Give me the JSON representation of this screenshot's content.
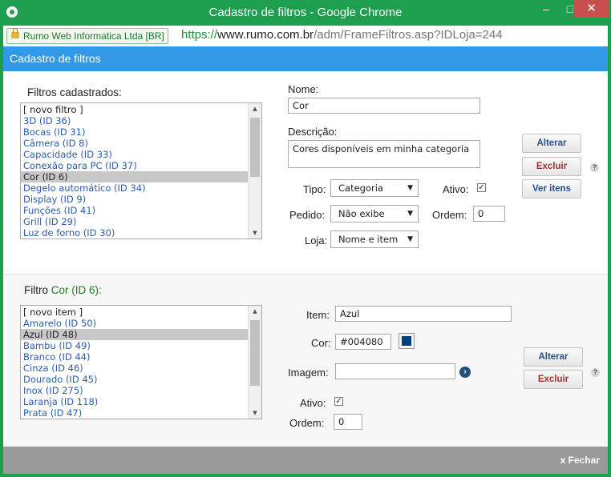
{
  "window": {
    "title": "Cadastro de filtros - Google Chrome",
    "minimize": "–",
    "maximize": "□",
    "close": "✕"
  },
  "addressbar": {
    "security_label": "Rumo Web Informatica Ltda [BR]",
    "url_protocol": "https://",
    "url_domain": "www.rumo.com.br",
    "url_path": "/adm/FrameFiltros.asp?IDLoja=244"
  },
  "header": {
    "title": "Cadastro de filtros"
  },
  "filters": {
    "heading": "Filtros cadastrados:",
    "items": [
      "[ novo filtro ]",
      "3D (ID 36)",
      "Bocas (ID 31)",
      "Câmera (ID 8)",
      "Capacidade (ID 33)",
      "Conexão para PC (ID 37)",
      "Cor (ID 6)",
      "Degelo automático (ID 34)",
      "Display (ID 9)",
      "Funções (ID 41)",
      "Grill (ID 29)",
      "Luz de forno (ID 30)"
    ],
    "selected_index": 6
  },
  "form": {
    "nome_label": "Nome:",
    "nome_value": "Cor",
    "descricao_label": "Descrição:",
    "descricao_value": "Cores disponíveis em minha categoria",
    "tipo_label": "Tipo:",
    "tipo_value": "Categoria",
    "ativo_label": "Ativo:",
    "ativo_checked": true,
    "pedido_label": "Pedido:",
    "pedido_value": "Não exibe",
    "ordem_label": "Ordem:",
    "ordem_value": "0",
    "loja_label": "Loja:",
    "loja_value": "Nome e item",
    "btn_alterar": "Alterar",
    "btn_excluir": "Excluir",
    "btn_ver_itens": "Ver itens",
    "help": "?"
  },
  "filtro_items": {
    "heading_prefix": "Filtro",
    "heading_name": "Cor (ID 6):",
    "items": [
      "[ novo item ]",
      "Amarelo (ID 50)",
      "Azul (ID 48)",
      "Bambu (ID 49)",
      "Branco (ID 44)",
      "Cinza (ID 46)",
      "Dourado (ID 45)",
      "Inox (ID 275)",
      "Laranja (ID 118)",
      "Prata (ID 47)"
    ],
    "selected_index": 2
  },
  "item_form": {
    "item_label": "Item:",
    "item_value": "Azul",
    "cor_label": "Cor:",
    "cor_value": "#004080",
    "imagem_label": "Imagem:",
    "imagem_value": "",
    "ativo_label": "Ativo:",
    "ativo_checked": true,
    "ordem_label": "Ordem:",
    "ordem_value": "0",
    "btn_alterar": "Alterar",
    "btn_excluir": "Excluir",
    "help": "?"
  },
  "footer": {
    "close_label": "x Fechar"
  },
  "colors": {
    "titlebar": "#1e9e4f",
    "header": "#3399e6",
    "link": "#2a5db0",
    "swatch": "#004080",
    "filter_name": "#1e7a1e"
  }
}
